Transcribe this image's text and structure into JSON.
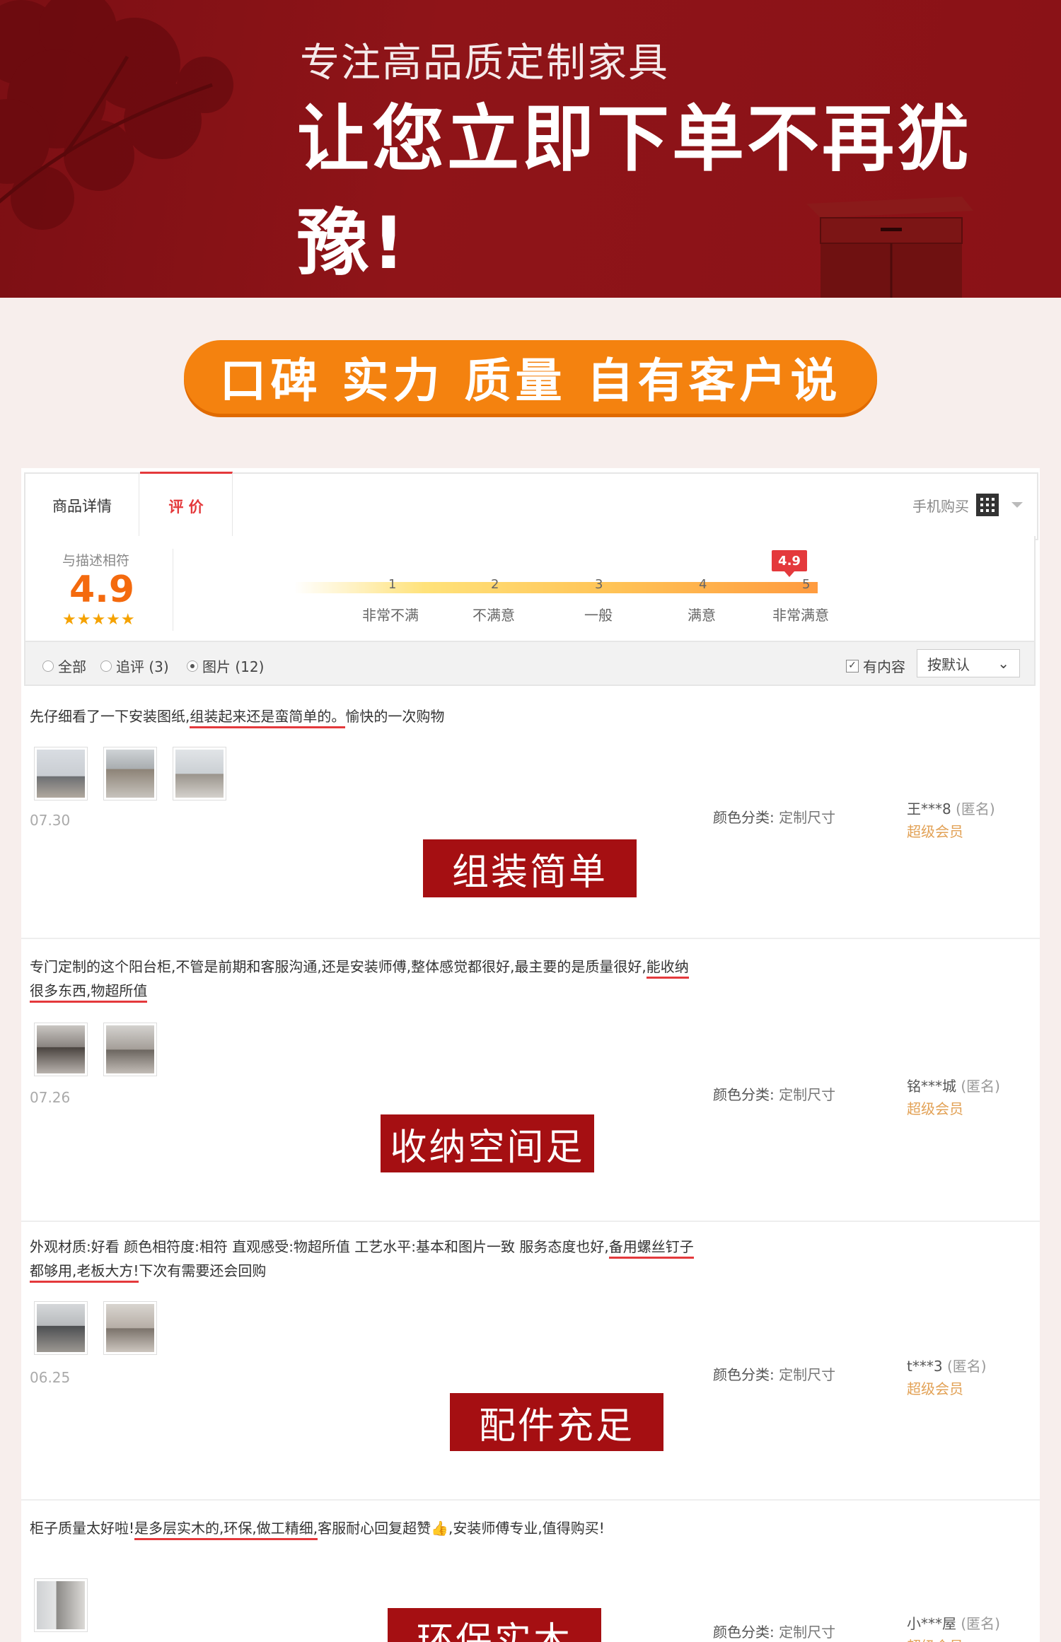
{
  "hero": {
    "subtitle": "专注高品质定制家具",
    "title": "让您立即下单不再犹豫!"
  },
  "slogan": "口碑 实力 质量 自有客户说",
  "tabs": [
    {
      "label": "商品详情"
    },
    {
      "label": "评  价"
    }
  ],
  "mobile_buy": "手机购买",
  "rating": {
    "label": "与描述相符",
    "score": "4.9",
    "stars": "★★★★★",
    "bubble": "4.9",
    "scale": [
      {
        "num": "1",
        "label": "非常不满"
      },
      {
        "num": "2",
        "label": "不满意"
      },
      {
        "num": "3",
        "label": "一般"
      },
      {
        "num": "4",
        "label": "满意"
      },
      {
        "num": "5",
        "label": "非常满意"
      }
    ]
  },
  "filter": {
    "all": "全部",
    "follow": "追评 (3)",
    "pics": "图片 (12)",
    "has_content": "有内容",
    "sort": "按默认"
  },
  "color_label": "颜色分类:",
  "color_value": "定制尺寸",
  "vip_label": "超级会员",
  "anon_label": "(匿名)",
  "reviews": [
    {
      "text_a": "先仔细看了一下安装图纸,",
      "text_ul": "组装起来还是蛮简单的。",
      "text_b": "愉快的一次购物",
      "date": "07.30",
      "user": "王***8",
      "tag": "组装简单"
    },
    {
      "text_a": "专门定制的这个阳台柜,不管是前期和客服沟通,还是安装师傅,整体感觉都很好,最主要的是质量很好,",
      "text_ul": "能收纳很多东西,物超所值",
      "text_b": "",
      "date": "07.26",
      "user": "铭***城",
      "tag": "收纳空间足"
    },
    {
      "text_a": "外观材质:好看 颜色相符度:相符 直观感受:物超所值 工艺水平:基本和图片一致 服务态度也好,",
      "text_ul": "备用螺丝钉子都够用,老板大方!",
      "text_b": "下次有需要还会回购",
      "date": "06.25",
      "user": "t***3",
      "tag": "配件充足"
    },
    {
      "text_a": "柜子质量太好啦!",
      "text_ul": "是多层实木的,环保,做工精细,",
      "text_b": "客服耐心回复超赞👍,安装师傅专业,值得购买!",
      "date": "",
      "user": "小***屋",
      "tag": "环保实木"
    }
  ]
}
